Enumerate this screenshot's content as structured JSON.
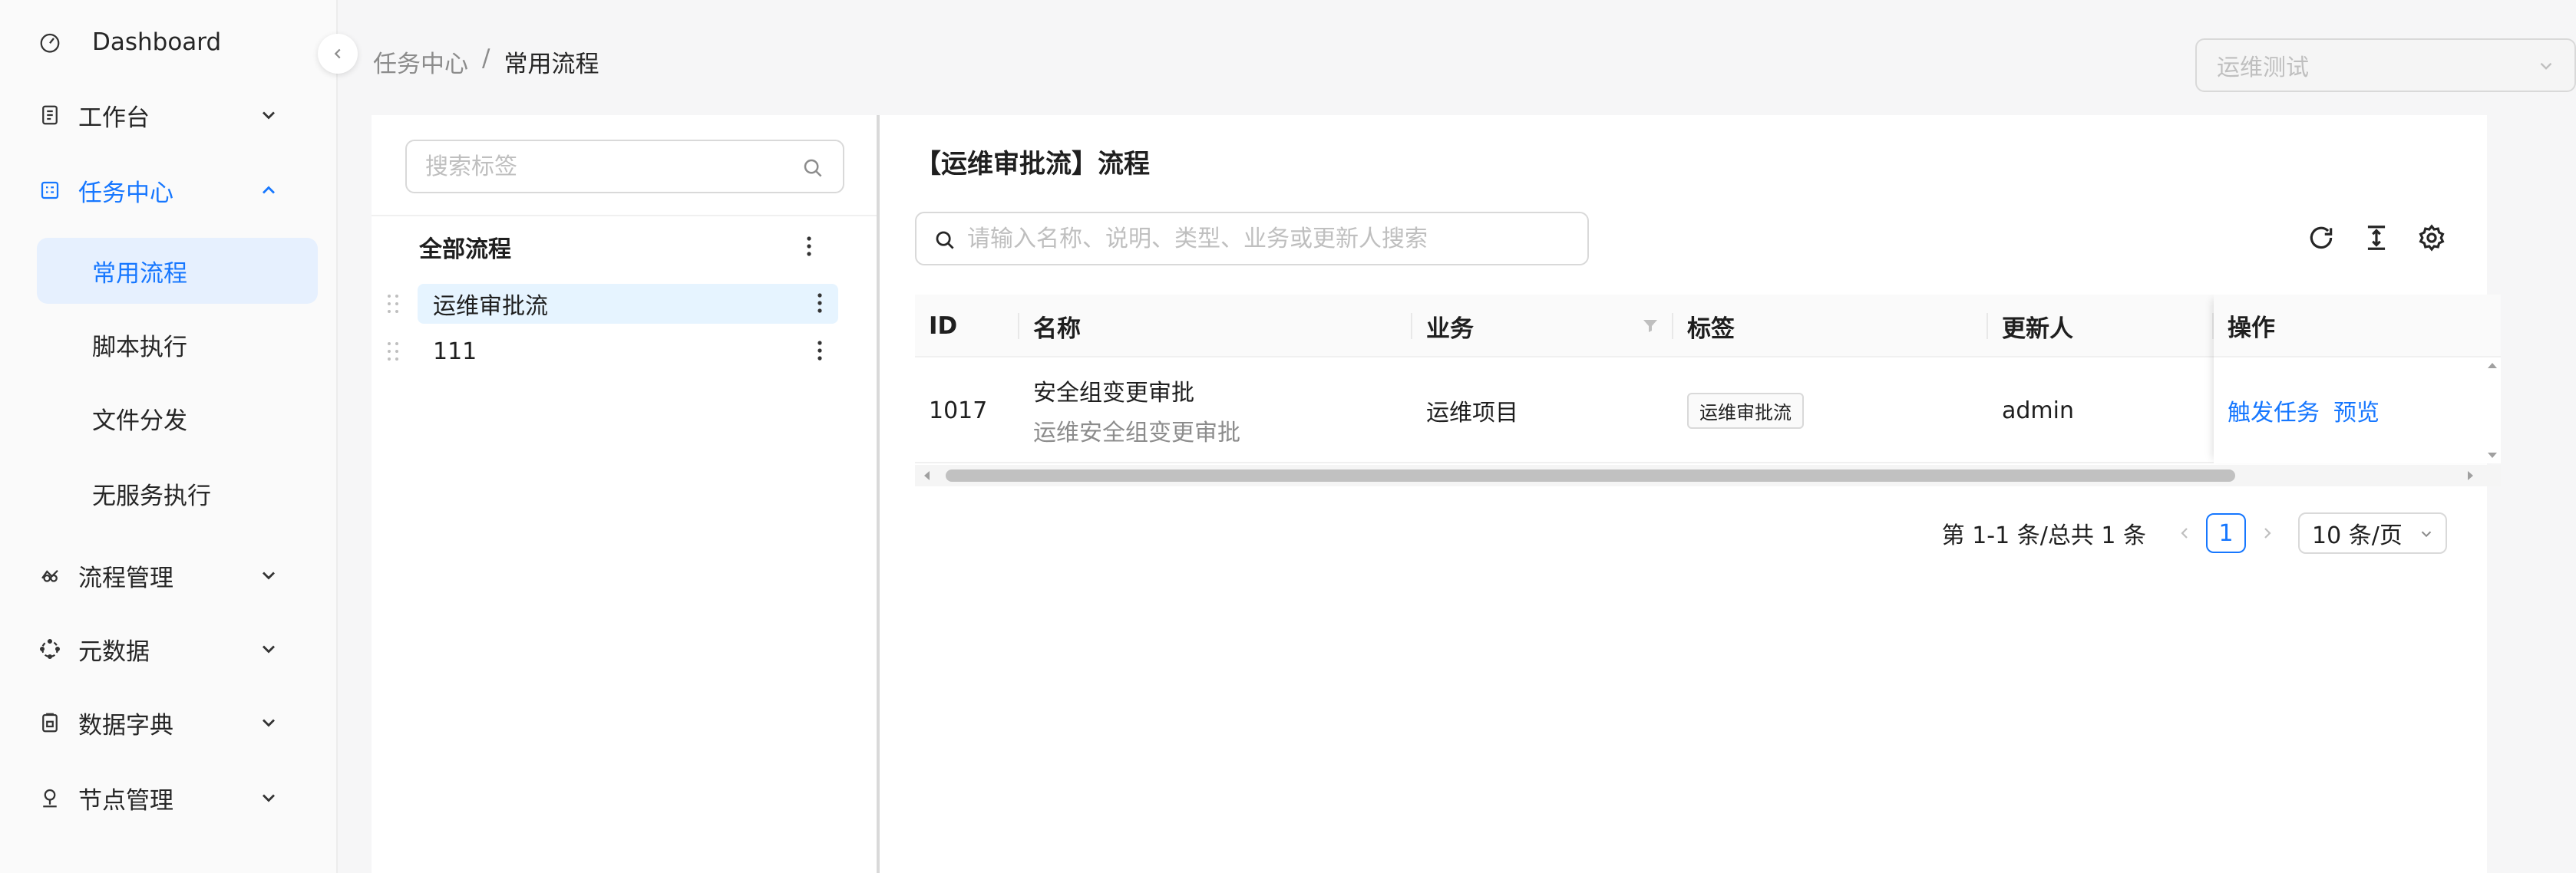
{
  "sidebar": {
    "dashboard": "Dashboard",
    "workbench": "工作台",
    "task_center": "任务中心",
    "task_children": [
      "常用流程",
      "脚本执行",
      "文件分发",
      "无服务执行"
    ],
    "flow_mgmt": "流程管理",
    "metadata": "元数据",
    "dictionary": "数据字典",
    "node_mgmt": "节点管理"
  },
  "breadcrumb": {
    "parent": "任务中心",
    "sep": "/",
    "current": "常用流程"
  },
  "env_select": {
    "value": "运维测试"
  },
  "tag_panel": {
    "search_placeholder": "搜索标签",
    "root": "全部流程",
    "items": [
      "运维审批流",
      "111"
    ]
  },
  "main": {
    "title": "【运维审批流】流程",
    "search_placeholder": "请输入名称、说明、类型、业务或更新人搜索",
    "columns": {
      "id": "ID",
      "name": "名称",
      "business": "业务",
      "tag": "标签",
      "updater": "更新人",
      "actions": "操作"
    },
    "rows": [
      {
        "id": "1017",
        "name": "安全组变更审批",
        "desc": "运维安全组变更审批",
        "business": "运维项目",
        "tag": "运维审批流",
        "updater": "admin",
        "action_trigger": "触发任务",
        "action_preview": "预览"
      }
    ],
    "pagination": {
      "total": "第 1-1 条/总共 1 条",
      "current": "1",
      "page_size": "10 条/页"
    }
  },
  "colors": {
    "accent": "#1677ff",
    "selected_bg": "#e6f0fe"
  }
}
